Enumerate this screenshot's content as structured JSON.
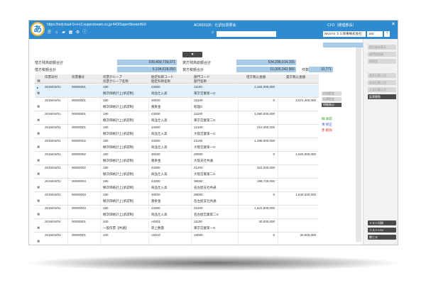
{
  "titlebar": {
    "logo": "あ",
    "url": "https://redcloud-0-nrv2.superstream.co.jp:443/SuperStreamNX/",
    "screen_title": "ACR00100：仕訳伝票照会",
    "user": "CFO（経理部長）",
    "close": "✕",
    "search_placeholder": "",
    "company": "NKSYS ＳＳ商事株式会社",
    "zoom": "100",
    "help": "?"
  },
  "toggle_label": "▼",
  "summary": {
    "debit_total_label": "借方残高総額合計",
    "debit_total": "539,409,739,071",
    "credit_total_label": "貸方残高総額合計",
    "credit_total": "534,298,014,155",
    "debit_tax_label": "借方税額合計",
    "debit_tax": "5,194,618,050",
    "credit_tax_label": "貸方税額合計",
    "credit_tax": "10,306,342,966",
    "count_label": "件数",
    "count": "10,771"
  },
  "grid": {
    "headers_top": [
      "伝票日付",
      "伝票番号",
      "伝票グループ",
      "勘定科目コード",
      "部門コード",
      "借方税込金額",
      "貸方税込金額"
    ],
    "headers_bottom": [
      "伝票グループ名称",
      "勘定科目名称",
      "部門名称"
    ],
    "rows": [
      {
        "date": "2016/04/01",
        "no": "00000001",
        "group": "190",
        "group_name": "棚次価格計上(承認制)",
        "acct": "43300",
        "acct_name": "商品仕入高",
        "dept": "11100",
        "dept_name": "東京営業第一G",
        "debit": "2,484,000,000",
        "credit": ""
      },
      {
        "date": "2016/04/01",
        "no": "00000001",
        "group": "190",
        "group_name": "棚次価格計上(承認制)",
        "acct": "30400",
        "acct_name": "買掛金",
        "dept": "15100",
        "dept_name": "経理G",
        "debit": "0",
        "credit": "3,974,400,000"
      },
      {
        "date": "2016/04/01",
        "no": "00000001",
        "group": "190",
        "group_name": "棚次価格計上(承認制)",
        "acct": "43300",
        "acct_name": "商品仕入高",
        "dept": "11200",
        "dept_name": "東京営業第二G",
        "debit": "1,080,000,000",
        "credit": ""
      },
      {
        "date": "2016/04/01",
        "no": "00000001",
        "group": "190",
        "group_name": "棚次価格計上(承認制)",
        "acct": "43300",
        "acct_name": "商品仕入高",
        "dept": "12100",
        "dept_name": "大阪営業第一G",
        "debit": "410,400,000",
        "credit": ""
      },
      {
        "date": "2016/04/01",
        "no": "00000002",
        "group": "190",
        "group_name": "棚次価格計上(承認制)",
        "acct": "43300",
        "acct_name": "商品仕入高",
        "dept": "21100",
        "dept_name": "大阪営業第一G",
        "debit": "1,296,000,000",
        "credit": ""
      },
      {
        "date": "2016/04/01",
        "no": "00000002",
        "group": "190",
        "group_name": "棚次価格計上(承認制)",
        "acct": "30400",
        "acct_name": "買掛金",
        "dept": "29000",
        "dept_name": "大阪支社共通",
        "debit": "0",
        "credit": "1,620,000,000"
      },
      {
        "date": "2016/04/01",
        "no": "00000002",
        "group": "190",
        "group_name": "棚次価格計上(承認制)",
        "acct": "43300",
        "acct_name": "商品仕入高",
        "dept": "21200",
        "dept_name": "大阪営業第二G",
        "debit": "324,000,000",
        "credit": ""
      },
      {
        "date": "2016/04/01",
        "no": "00000003",
        "group": "190",
        "group_name": "棚次価格計上(承認制)",
        "acct": "43300",
        "acct_name": "商品仕入高",
        "dept": "39000",
        "dept_name": "名古屋支社共通",
        "debit": "198,720,000",
        "credit": ""
      },
      {
        "date": "2016/04/01",
        "no": "00000003",
        "group": "190",
        "group_name": "棚次価格計上(承認制)",
        "acct": "30400",
        "acct_name": "買掛金",
        "dept": "39000",
        "dept_name": "名古屋支社共通",
        "debit": "0",
        "credit": "1,840,320,000"
      },
      {
        "date": "2016/04/01",
        "no": "00000003",
        "group": "190",
        "group_name": "棚次価格計上(承認制)",
        "acct": "43300",
        "acct_name": "商品仕入高",
        "dept": "31200",
        "dept_name": "名古屋営業第二G",
        "debit": "1,641,600,000",
        "credit": ""
      },
      {
        "date": "2016/04/04",
        "no": "00000001",
        "group": "100",
        "group_name": "一般伝票【共通】",
        "acct": "A0001",
        "acct_name": "売上数量",
        "dept": "11100",
        "dept_name": "東京営業第一G",
        "debit": "30,000,000",
        "credit": ""
      },
      {
        "date": "2016/04/04",
        "no": "00000001",
        "group": "100",
        "group_name": "",
        "acct": "A0010",
        "acct_name": "",
        "dept": "19000",
        "dept_name": "",
        "debit": "0",
        "credit": "30,000,000"
      }
    ]
  },
  "right_panel": {
    "buttons": [
      "仕訳照会",
      "伝票照会",
      "明細表示"
    ],
    "legend": [
      "緑:承認",
      "青:修正",
      "赤:削除"
    ]
  },
  "side_panel": {
    "top_buttons": [
      "照合済み表示",
      "部門別残高",
      "再照会"
    ],
    "mid_buttons": [
      "会計伝票入力",
      "支払伝票入力",
      "入金伝票入力",
      "証票閲覧"
    ],
    "bottom_buttons": [
      "リスト印刷",
      "リストCSV",
      "閉じる"
    ]
  },
  "colors": {
    "titlebar": "#2e8bcf",
    "value_box": "#a7cbe8",
    "legend_green": "#2aa02a",
    "legend_blue": "#2a5ad8",
    "legend_red": "#d82a2a"
  }
}
